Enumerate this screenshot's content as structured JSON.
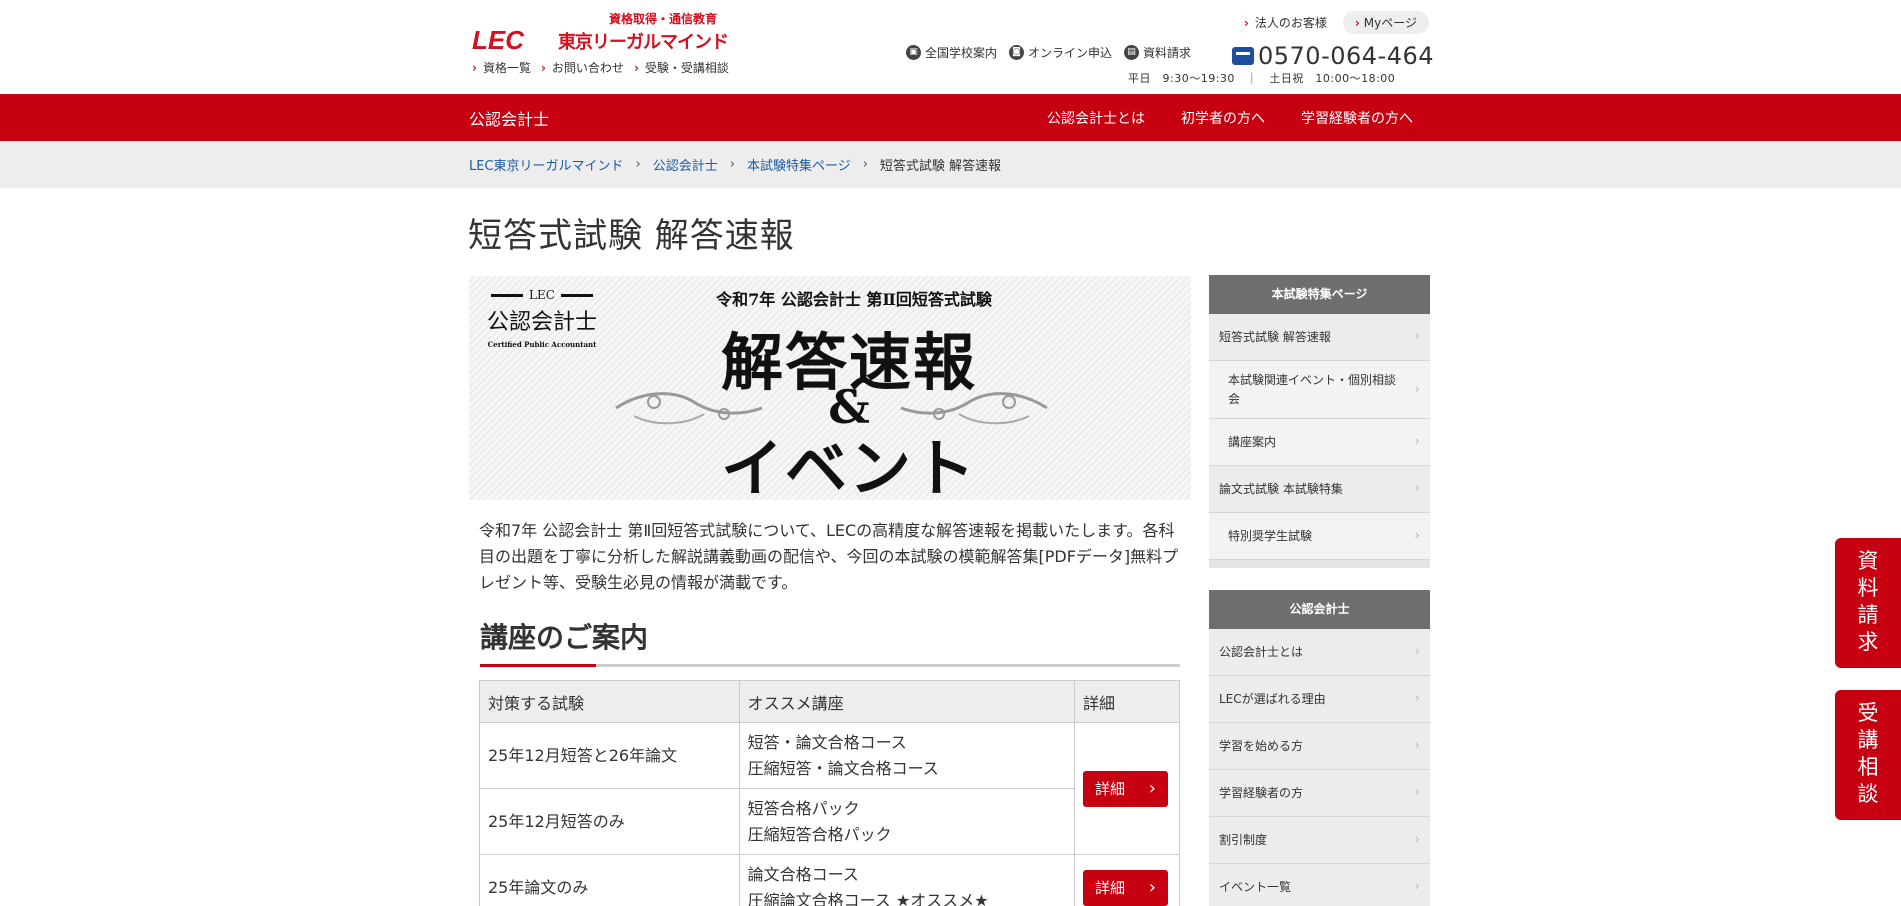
{
  "header": {
    "tagline": "資格取得・通信教育",
    "logo_text": "東京リーガルマインド",
    "logo_mark": "LEC",
    "util_links": [
      "資格一覧",
      "お問い合わせ",
      "受験・受講相談"
    ],
    "corp_link": "法人のお客様",
    "mypage": "Myページ",
    "icon_links": [
      {
        "label": "全国学校案内",
        "icon": "building-icon"
      },
      {
        "label": "オンライン申込",
        "icon": "cart-icon"
      },
      {
        "label": "資料請求",
        "icon": "document-icon"
      }
    ],
    "phone": "0570-064-464",
    "hours": "平日　9:30～19:30　｜　土日祝　10:00～18:00"
  },
  "nav": {
    "title": "公認会計士",
    "menu": [
      "公認会計士とは",
      "初学者の方へ",
      "学習経験者の方へ"
    ]
  },
  "breadcrumb": [
    "LEC東京リーガルマインド",
    "公認会計士",
    "本試験特集ページ",
    "短答式試験 解答速報"
  ],
  "main": {
    "title": "短答式試験 解答速報",
    "hero": {
      "logo_lec": "LEC",
      "logo_jp": "公認会計士",
      "logo_en": "Certified Public Accountant",
      "subtitle": "令和7年 公認会計士 第Ⅱ回短答式試験",
      "line1": "解答速報",
      "amp": "&",
      "line2": "イベント"
    },
    "intro": "令和7年 公認会計士 第Ⅱ回短答式試験について、LECの高精度な解答速報を掲載いたします。各科目の出題を丁寧に分析した解説講義動画の配信や、今回の本試験の模範解答集[PDFデータ]無料プレゼント等、受験生必見の情報が満載です。",
    "section_title": "講座のご案内",
    "table": {
      "headers": [
        "対策する試験",
        "オススメ講座",
        "詳細"
      ],
      "rows": [
        {
          "exam": "25年12月短答と26年論文",
          "courses": [
            "短答・論文合格コース",
            "圧縮短答・論文合格コース"
          ]
        },
        {
          "exam": "25年12月短答のみ",
          "courses": [
            "短答合格パック",
            "圧縮短答合格パック"
          ]
        },
        {
          "exam": "25年論文のみ",
          "courses": [
            "論文合格コース",
            "圧縮論文合格コース ★オススメ★"
          ]
        }
      ],
      "detail_label": "詳細"
    }
  },
  "sidebar": {
    "block1": {
      "head": "本試験特集ページ",
      "items": [
        {
          "label": "短答式試験 解答速報"
        },
        {
          "label": "本試験関連イベント・個別相談会"
        },
        {
          "label": "講座案内"
        },
        {
          "label": "論文式試験 本試験特集"
        },
        {
          "label": "特別奨学生試験"
        }
      ]
    },
    "block2": {
      "head": "公認会計士",
      "items": [
        {
          "label": "公認会計士とは"
        },
        {
          "label": "LECが選ばれる理由"
        },
        {
          "label": "学習を始める方"
        },
        {
          "label": "学習経験者の方"
        },
        {
          "label": "割引制度"
        },
        {
          "label": "イベント一覧"
        }
      ]
    }
  },
  "floating": {
    "request": [
      "資",
      "料",
      "請",
      "求"
    ],
    "consult": [
      "受",
      "講",
      "相",
      "談"
    ]
  },
  "colors": {
    "brand_red": "#c70011",
    "link_blue": "#1b5aa5"
  }
}
